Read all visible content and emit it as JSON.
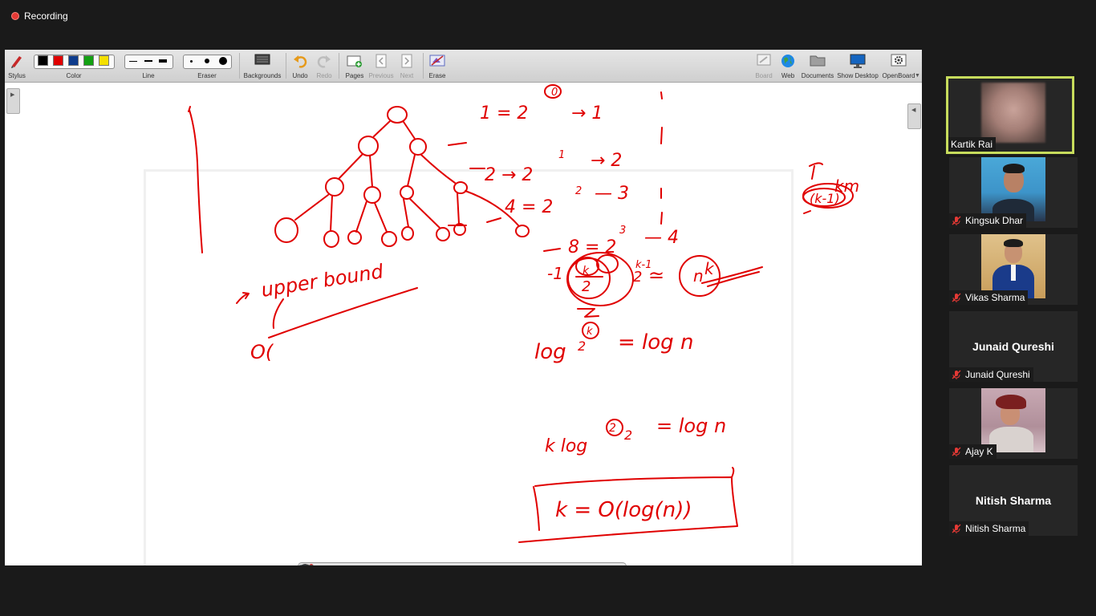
{
  "recording": {
    "label": "Recording"
  },
  "toolbar": {
    "stylus": "Stylus",
    "color": "Color",
    "colors": [
      "#000000",
      "#e00000",
      "#0e3c8c",
      "#12a012",
      "#f5e000"
    ],
    "line": "Line",
    "eraser": "Eraser",
    "backgrounds": "Backgrounds",
    "undo": "Undo",
    "redo": "Redo",
    "pages": "Pages",
    "previous": "Previous",
    "next": "Next",
    "erase": "Erase",
    "board": "Board",
    "web": "Web",
    "documents": "Documents",
    "show_desktop": "Show Desktop",
    "openboard": "OpenBoard"
  },
  "whiteboard": {
    "ink_color": "#e00000",
    "handwriting": {
      "row1": "1 = 2",
      "row1_exp": "0",
      "row1_arrow_val": "→ 1",
      "row2": "2 → 2",
      "row2_exp": "1",
      "row2_val": "→ 2",
      "row3": "4 = 2",
      "row3_exp": "2",
      "row3_val": "— 3",
      "row4": "8 = 2",
      "row4_exp": "3",
      "row4_val": "— 4",
      "row5": "-1",
      "row5_pow": "2",
      "row5_exp": "k-1",
      "row5_val": "k",
      "side_word": "km",
      "side_circle": "(k-1)",
      "upper_bound": "upper bound",
      "big_o": "O(",
      "frac_top": "k",
      "frac_bottom": "2",
      "approx": "≃",
      "approx_val": "n",
      "log_line": "log",
      "log_base": "2",
      "log_exp": "k",
      "log_eq": "= log n",
      "klog_line": "k log",
      "klog_sub": "2",
      "klog_exp": "2",
      "klog_eq": "= log n",
      "result": "k = O(log(n))"
    }
  },
  "participants": [
    {
      "name": "Kartik Rai",
      "active": true,
      "video": "blurred"
    },
    {
      "name": "Kingsuk Dhar",
      "muted": true,
      "video": "photo"
    },
    {
      "name": "Vikas Sharma",
      "muted": true,
      "video": "photo"
    },
    {
      "name": "Junaid Qureshi",
      "muted": true,
      "video": "none",
      "center_label": "Junaid Qureshi"
    },
    {
      "name": "Ajay K",
      "muted": true,
      "video": "photo"
    },
    {
      "name": "Nitish Sharma",
      "muted": true,
      "video": "none",
      "center_label": "Nitish Sharma"
    }
  ]
}
